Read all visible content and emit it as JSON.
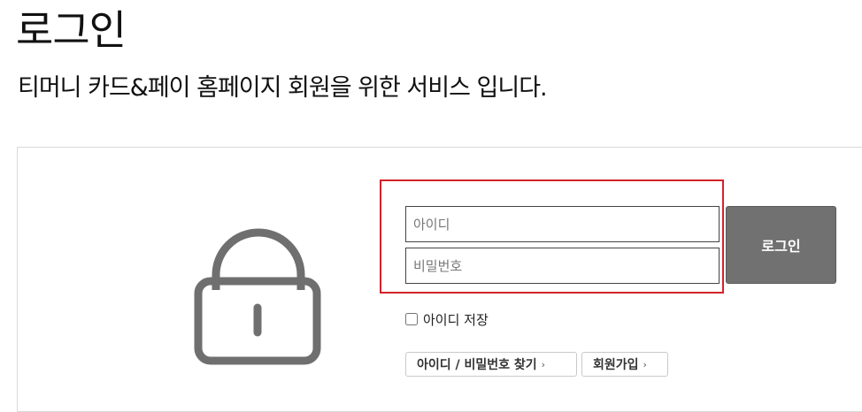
{
  "header": {
    "title": "로그인",
    "subtitle": "티머니 카드&페이 홈페이지 회원을 위한 서비스 입니다."
  },
  "form": {
    "id_placeholder": "아이디",
    "pw_placeholder": "비밀번호",
    "login_label": "로그인",
    "remember_label": "아이디 저장",
    "remember_checked": false
  },
  "links": {
    "find_label": "아이디 / 비밀번호 찾기",
    "join_label": "회원가입",
    "chevron": "›"
  },
  "icons": {
    "lock": "lock-icon",
    "chevron": "chevron-right-icon"
  },
  "colors": {
    "highlight": "#d2232a",
    "button": "#717171",
    "lock": "#6f6f6f"
  }
}
